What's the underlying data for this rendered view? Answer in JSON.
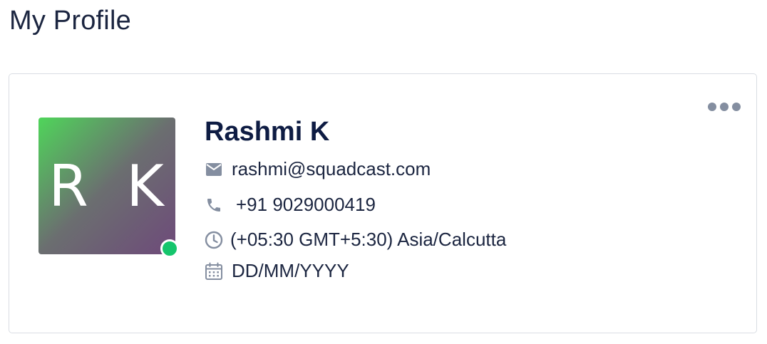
{
  "page": {
    "title": "My Profile"
  },
  "profile": {
    "initials": "R K",
    "name": "Rashmi K",
    "email": "rashmi@squadcast.com",
    "phone": "+91 9029000419",
    "timezone": "(+05:30 GMT+5:30) Asia/Calcutta",
    "date_of_birth": "DD/MM/YYYY",
    "status": "online"
  },
  "icons": {
    "email": "mail-icon",
    "phone": "phone-icon",
    "timezone": "clock-icon",
    "date": "calendar-icon",
    "more": "more-horizontal-icon"
  },
  "colors": {
    "status_online": "#15c56c",
    "icon_gray": "#848ea0",
    "name_text": "#0e1c43",
    "avatar_gradient_start": "#4fd55a",
    "avatar_gradient_end": "#6e4a7a"
  }
}
